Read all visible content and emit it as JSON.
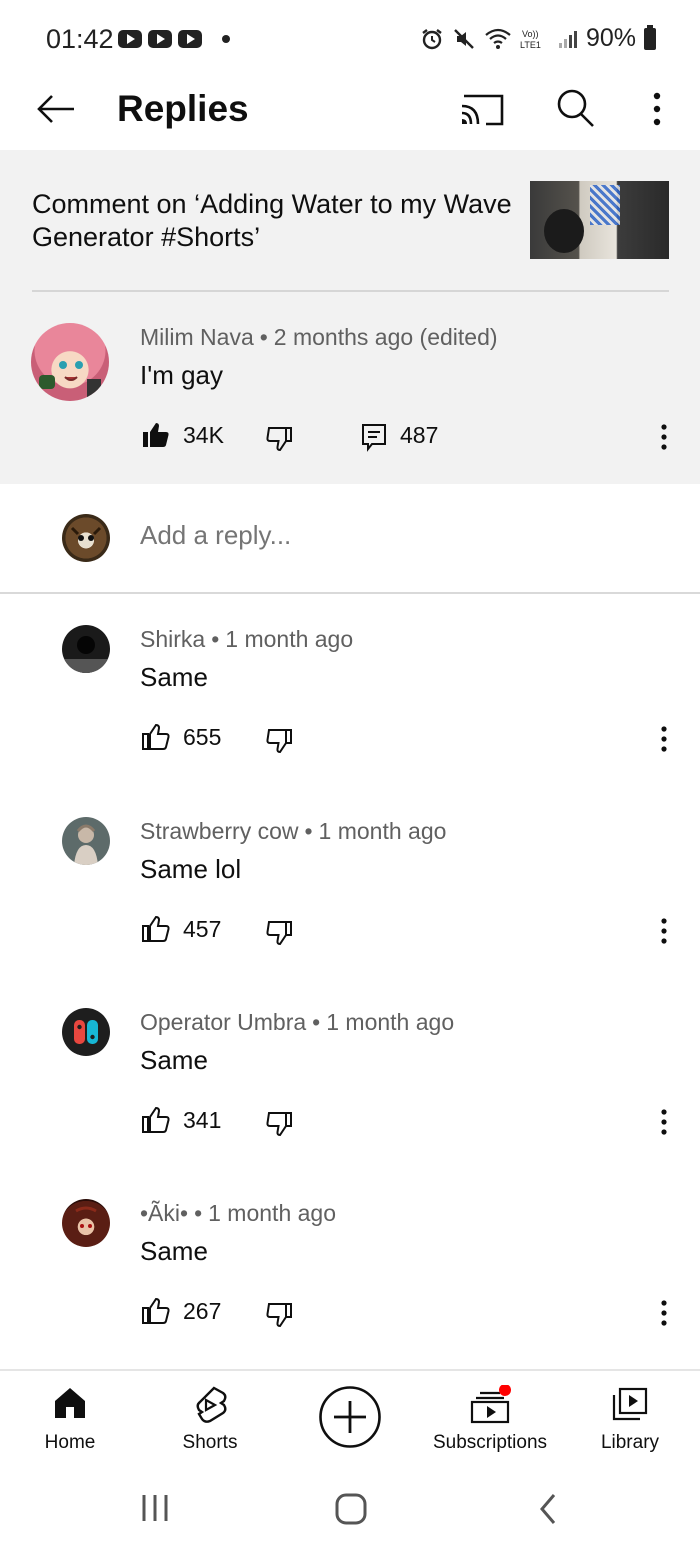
{
  "status_bar": {
    "time": "01:42",
    "battery": "90%"
  },
  "header": {
    "title": "Replies"
  },
  "context": {
    "text": "Comment on ‘Adding Water to my Wave Generator #Shorts’"
  },
  "main_comment": {
    "author": "Milim Nava",
    "time": "2 months ago (edited)",
    "text": "I'm gay",
    "likes": "34K",
    "replies": "487"
  },
  "add_reply": {
    "placeholder": "Add a reply..."
  },
  "replies": [
    {
      "author": "Shirka",
      "time": "1 month ago",
      "text": "Same",
      "likes": "655"
    },
    {
      "author": "Strawberry cow",
      "time": "1 month ago",
      "text": "Same lol",
      "likes": "457"
    },
    {
      "author": "Operator Umbra",
      "time": "1 month ago",
      "text": "Same",
      "likes": "341"
    },
    {
      "author": "•Ãki•",
      "time": "1 month ago",
      "text": "Same",
      "likes": "267"
    }
  ],
  "bottom_nav": {
    "home": "Home",
    "shorts": "Shorts",
    "subscriptions": "Subscriptions",
    "library": "Library"
  },
  "colors": {
    "notification_dot": "#ff0000",
    "switch_red": "#e8473f",
    "switch_blue": "#17b7d5"
  }
}
